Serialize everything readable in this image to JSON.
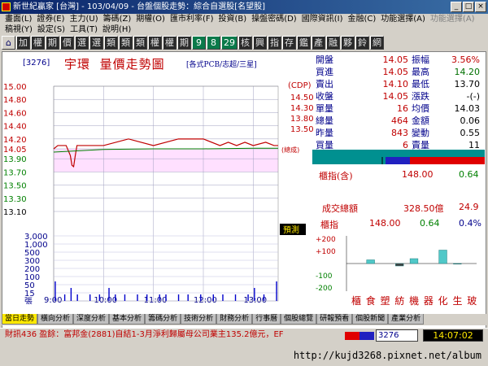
{
  "window": {
    "title": "新世紀贏家 [台灣] - 103/04/09 - 台盤個股走勢：綜合自選股[名望股]",
    "buttons": [
      "_",
      "□",
      "×"
    ]
  },
  "menu": {
    "row1": [
      "畫面(L)",
      "證券(E)",
      "主力(U)",
      "籌碼(Z)",
      "期權(O)",
      "匯市利率(F)",
      "投資(B)",
      "操盤密碼(D)",
      "國際資訊(I)",
      "金融(C)",
      "功能選擇(A)",
      "功能選擇(A)"
    ],
    "row1_disabled": [
      false,
      false,
      false,
      false,
      false,
      false,
      false,
      false,
      false,
      false,
      false,
      true
    ],
    "row2": [
      "稿視(Y)",
      "設定(S)",
      "工具(T)",
      "說明(H)"
    ]
  },
  "toolbar": {
    "items": [
      "⌂",
      "加",
      "權",
      "期",
      "價",
      "選",
      "選",
      "類",
      "類",
      "類",
      "權",
      "權",
      "期",
      "9",
      "8",
      "29",
      "核",
      "興",
      "指",
      "存",
      "鑑",
      "產",
      "融",
      "夥",
      "鈴",
      "網"
    ]
  },
  "header": {
    "code": "[3276]",
    "name": "宇環",
    "title": "量價走勢圖",
    "subtitle": "[各式PCB/志超/三星]"
  },
  "chart_data": {
    "type": "line",
    "price_ticks": [
      "15.00",
      "14.80",
      "14.60",
      "14.40",
      "14.20",
      "14.05",
      "13.90",
      "13.70",
      "13.50",
      "13.30",
      "13.10"
    ],
    "ylim_price": [
      13.1,
      15.0
    ],
    "ref_price": 14.05,
    "volume_ticks": [
      "3,000",
      "1,000",
      "500",
      "300",
      "200",
      "100",
      "50",
      "15",
      "張"
    ],
    "time_ticks": [
      "9:00",
      "10:00",
      "11:00",
      "12:00",
      "13:00"
    ],
    "right_label": "(總成)",
    "badge": "預測",
    "series": [
      {
        "name": "price",
        "x": [
          0,
          5,
          15,
          20,
          22,
          24,
          26,
          28,
          30,
          40,
          60,
          90,
          120,
          150,
          180,
          200,
          210,
          220,
          230,
          240,
          255,
          265,
          270
        ],
        "y": [
          14.05,
          14.1,
          14.1,
          13.95,
          13.8,
          13.78,
          13.95,
          14.1,
          14.1,
          14.1,
          14.1,
          14.2,
          14.1,
          14.2,
          14.2,
          14.1,
          14.15,
          14.1,
          14.15,
          14.1,
          14.15,
          14.1,
          14.1
        ]
      },
      {
        "name": "avg",
        "x": [
          0,
          30,
          60,
          120,
          180,
          240,
          270
        ],
        "y": [
          14.0,
          14.02,
          14.04,
          14.05,
          14.05,
          14.06,
          14.06
        ]
      }
    ],
    "volume": [
      3,
      0,
      0,
      1,
      0,
      2,
      0,
      1,
      0,
      0,
      0,
      1,
      0,
      0,
      1,
      0,
      0,
      2,
      0,
      1,
      0,
      0,
      1,
      0,
      0,
      0,
      1,
      0,
      0,
      1,
      0,
      0,
      0,
      1,
      0,
      1,
      0,
      0,
      0,
      1,
      0,
      0,
      1,
      0,
      0,
      0,
      1,
      0,
      0,
      0,
      1,
      0,
      0,
      1,
      0,
      0,
      0,
      1,
      0,
      0,
      0,
      1,
      0,
      2,
      0,
      0,
      1,
      0,
      0,
      0,
      3
    ]
  },
  "quote": {
    "left_labels": [
      "開盤",
      "買進",
      "賣出",
      "收盤",
      "單量",
      "總量",
      "昨量",
      "買量"
    ],
    "left_values": [
      "14.05",
      "14.05",
      "14.10",
      "14.05",
      "16",
      "464",
      "843",
      "6"
    ],
    "right_labels": [
      "振幅",
      "最高",
      "最低",
      "漲跌",
      "均價",
      "金額",
      "變動",
      "賣量"
    ],
    "right_values": [
      "3.56%",
      "14.20",
      "13.70",
      "-(-)",
      "14.03",
      "0.06",
      "0.55",
      "11"
    ],
    "right_colors": [
      "#c00000",
      "#007000",
      "#000000",
      "#000000",
      "#000000",
      "#000000",
      "#000000",
      "#000000"
    ],
    "cdp_label": "(CDP)",
    "cdp_values": [
      "14.50",
      "14.30",
      "13.80",
      "13.50"
    ]
  },
  "index_panel": {
    "label": "櫃指(含)",
    "value": "148.00",
    "change": "0.64",
    "turnover_label": "成交總額",
    "turnover_value": "328.50億",
    "turnover_change": "24.9"
  },
  "sector_panel": {
    "label": "櫃指",
    "value": "148.00",
    "change": "0.64",
    "pct": "0.4%",
    "ticks": [
      "+200",
      "+100",
      "-100",
      "-200"
    ],
    "sectors": [
      "櫃",
      "食",
      "塑",
      "紡",
      "機",
      "器",
      "化",
      "生",
      "玻"
    ],
    "sector_values": [
      0,
      30,
      0,
      -20,
      40,
      0,
      110,
      -5,
      0
    ]
  },
  "tabs": [
    "當日走勢",
    "橫向分析",
    "深度分析",
    "基本分析",
    "籌碼分析",
    "技術分析",
    "財務分析",
    "行事曆",
    "個股總覽",
    "研報預看",
    "個股新聞",
    "產業分析"
  ],
  "status": {
    "news": "財訊436  盈餘：富邦金(2881)自結1-3月淨利歸屬母公司業主135.2億元，EF",
    "code": "3276",
    "clock": "14:07:02"
  },
  "footer": {
    "url": "http://kujd3268.pixnet.net/album"
  },
  "colors": {
    "price_line": "#c00000",
    "avg_line": "#008000",
    "ref_band": "#ffe0ff",
    "volume_bar": "#0000cc",
    "accent": "#0a246a"
  }
}
